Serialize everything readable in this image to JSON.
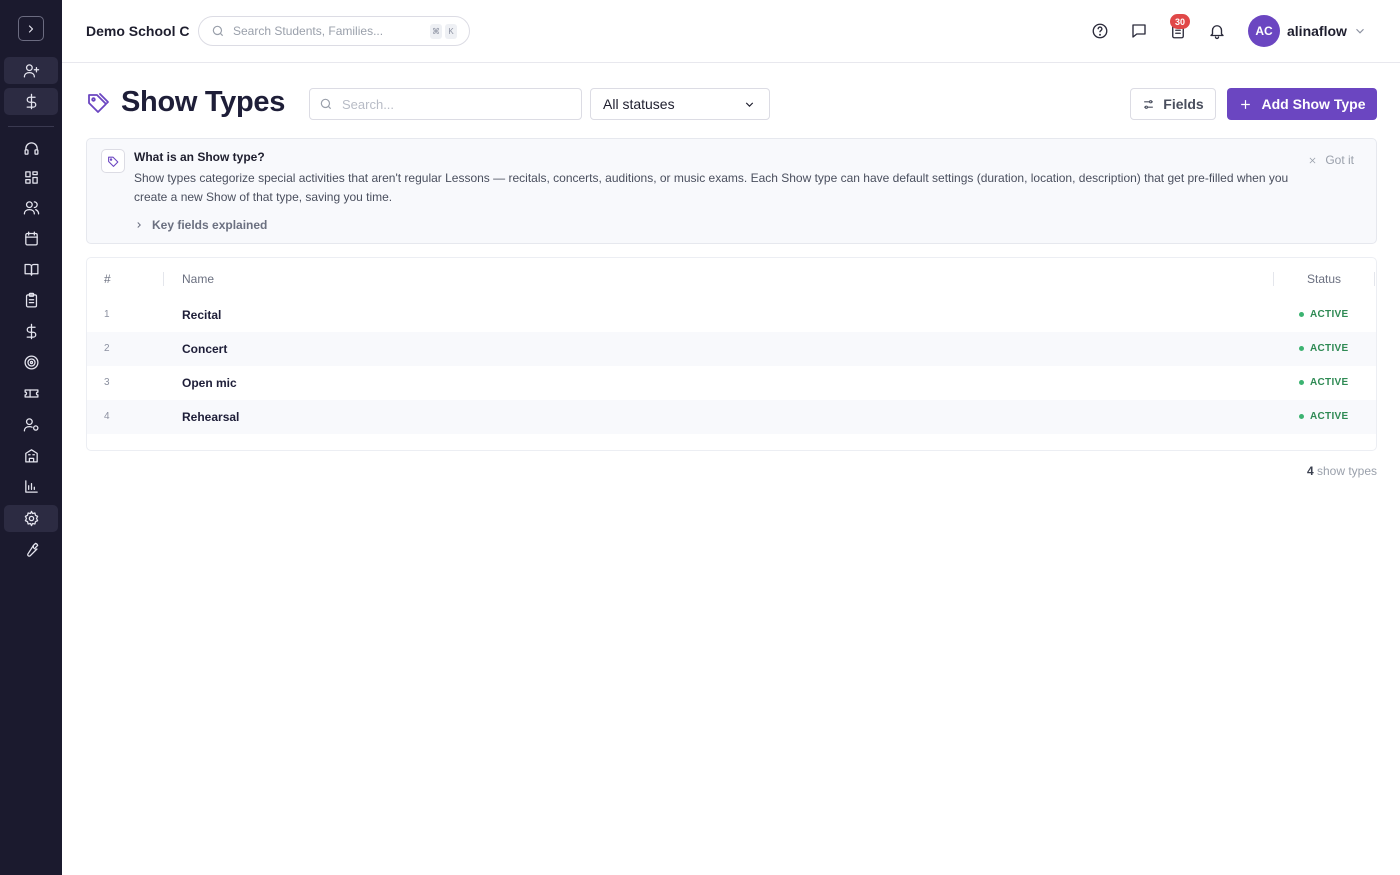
{
  "sidebar": {
    "items": [
      {
        "name": "user-plus-icon"
      },
      {
        "name": "dollar-icon"
      },
      {
        "name": "headset-icon"
      },
      {
        "name": "dashboard-icon"
      },
      {
        "name": "users-icon"
      },
      {
        "name": "calendar-icon"
      },
      {
        "name": "book-icon"
      },
      {
        "name": "clipboard-icon"
      },
      {
        "name": "dollar-icon"
      },
      {
        "name": "target-icon"
      },
      {
        "name": "ticket-icon"
      },
      {
        "name": "user-gear-icon"
      },
      {
        "name": "building-icon"
      },
      {
        "name": "bar-chart-icon"
      },
      {
        "name": "gear-icon"
      },
      {
        "name": "wrench-icon"
      }
    ]
  },
  "topbar": {
    "school_name": "Demo School C",
    "search_placeholder": "Search Students, Families...",
    "kbd_keys": [
      "⌘",
      "K"
    ],
    "tasks_badge": "30",
    "avatar_initials": "AC",
    "username": "alinaflow"
  },
  "page": {
    "title": "Show Types",
    "search_placeholder": "Search...",
    "status_filter": "All statuses",
    "fields_label": "Fields",
    "add_label": "Add Show Type"
  },
  "info": {
    "title": "What is an Show type?",
    "text": "Show types categorize special activities that aren't regular Lessons — recitals, concerts, auditions, or music exams. Each Show type can have default settings (duration, location, description) that get pre-filled when you create a new Show of that type, saving you time.",
    "key_fields_label": "Key fields explained",
    "dismiss_label": "Got it"
  },
  "table": {
    "columns": {
      "num": "#",
      "name": "Name",
      "status": "Status"
    },
    "rows": [
      {
        "num": "1",
        "name": "Recital",
        "status": "ACTIVE"
      },
      {
        "num": "2",
        "name": "Concert",
        "status": "ACTIVE"
      },
      {
        "num": "3",
        "name": "Open mic",
        "status": "ACTIVE"
      },
      {
        "num": "4",
        "name": "Rehearsal",
        "status": "ACTIVE"
      }
    ]
  },
  "footer": {
    "count": "4",
    "count_label": "show types"
  },
  "colors": {
    "accent": "#6b46c1",
    "sidebar_bg": "#1b1a2e",
    "status_active": "#2f8a54"
  }
}
